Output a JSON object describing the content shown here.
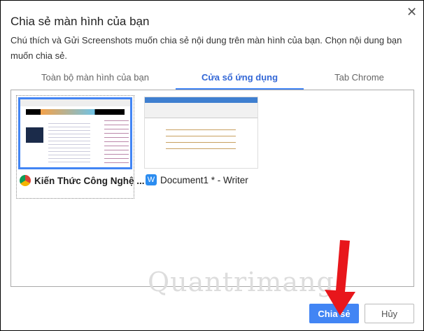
{
  "dialog": {
    "title": "Chia sẻ màn hình của bạn",
    "close_icon": "close-icon",
    "description": "Chú thích và Gửi Screenshots muốn chia sẻ nội dung trên màn hình của bạn. Chọn nội dung bạn muốn chia sẻ."
  },
  "tabs": [
    {
      "label": "Toàn bộ màn hình của bạn"
    },
    {
      "label": "Cửa sổ ứng dụng",
      "active": true
    },
    {
      "label": "Tab Chrome"
    }
  ],
  "windows": [
    {
      "label": "Kiến Thức Công Nghệ ...",
      "icon": "chrome-icon",
      "selected": true
    },
    {
      "label": "Document1 * - Writer",
      "icon": "wps-writer-icon"
    }
  ],
  "buttons": {
    "share": "Chia sẻ",
    "cancel": "Hủy"
  },
  "watermark": "Quantrimang",
  "colors": {
    "accent": "#4285f4",
    "arrow": "#e8161b"
  }
}
